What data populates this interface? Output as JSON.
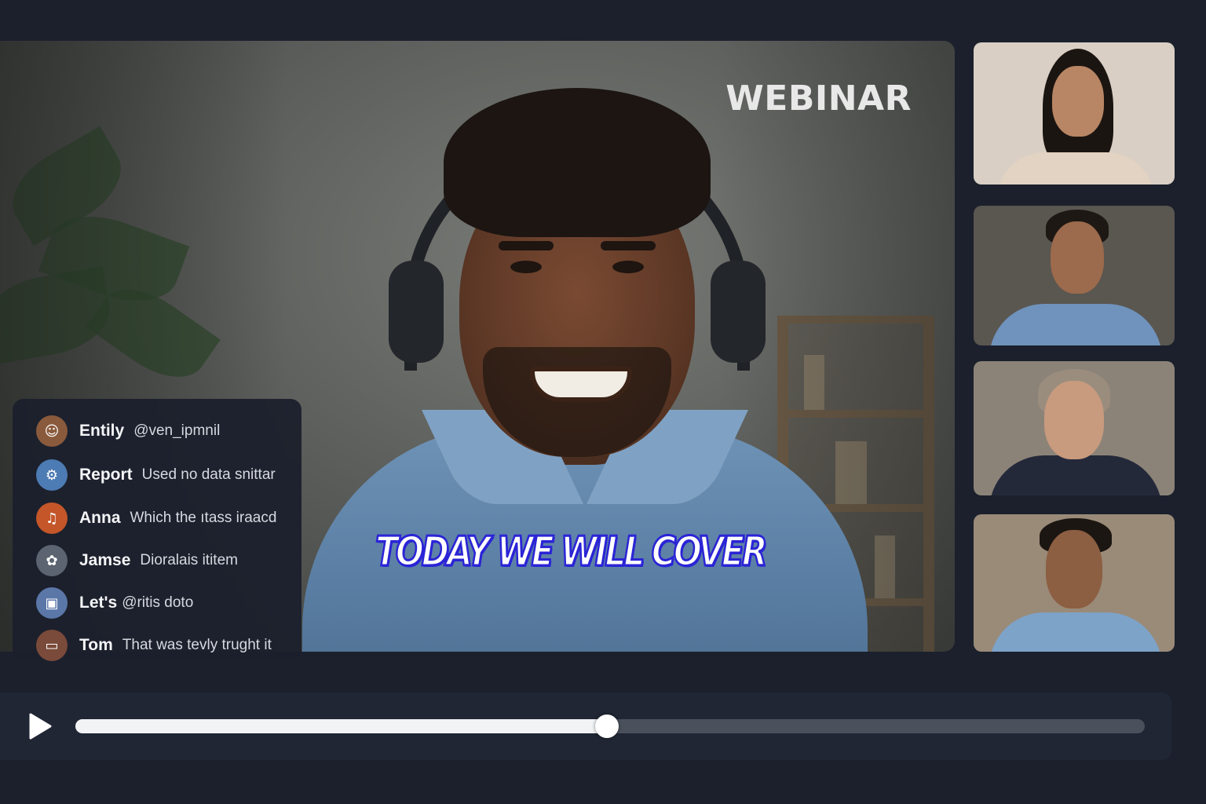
{
  "main_video": {
    "label": "WEBINAR",
    "caption": "TODAY WE WILL COVER"
  },
  "chat": {
    "messages": [
      {
        "name": "Entily",
        "text": "@ven_ipmnil",
        "avatar_color": "#8a5a3c",
        "avatar_glyph": "☺"
      },
      {
        "name": "Report",
        "text": "Used no data snittar",
        "avatar_color": "#4d7bb3",
        "avatar_glyph": "⚙"
      },
      {
        "name": "Anna",
        "text": "Which the ıtass iraacd",
        "avatar_color": "#c4562a",
        "avatar_glyph": "♫"
      },
      {
        "name": "Jamse",
        "text": "Dioralais ititem",
        "avatar_color": "#5b6470",
        "avatar_glyph": "✿"
      },
      {
        "name": "Let's",
        "text": "@ritis doto",
        "avatar_color": "#5a77a8",
        "avatar_glyph": "▣"
      },
      {
        "name": "Tom",
        "text": "That was tevly trught it",
        "avatar_color": "#7a4a3a",
        "avatar_glyph": "▭"
      }
    ]
  },
  "participants": [
    {
      "name": "participant-1",
      "bg": "#d9cfc4",
      "skin": "#b88664",
      "hair": "#1b1512",
      "shirt": "#e2d3c2"
    },
    {
      "name": "participant-2",
      "bg": "#5a5650",
      "skin": "#9c6a4c",
      "hair": "#1e1814",
      "shirt": "#6f93bd"
    },
    {
      "name": "participant-3",
      "bg": "#8c8378",
      "skin": "#c89a7e",
      "hair": "#9a8d7e",
      "shirt": "#24293a"
    },
    {
      "name": "participant-4",
      "bg": "#9a8a78",
      "skin": "#8c5e42",
      "hair": "#1c1612",
      "shirt": "#7da3c9"
    }
  ],
  "player": {
    "play_icon": "play-icon",
    "progress": 0.497
  }
}
